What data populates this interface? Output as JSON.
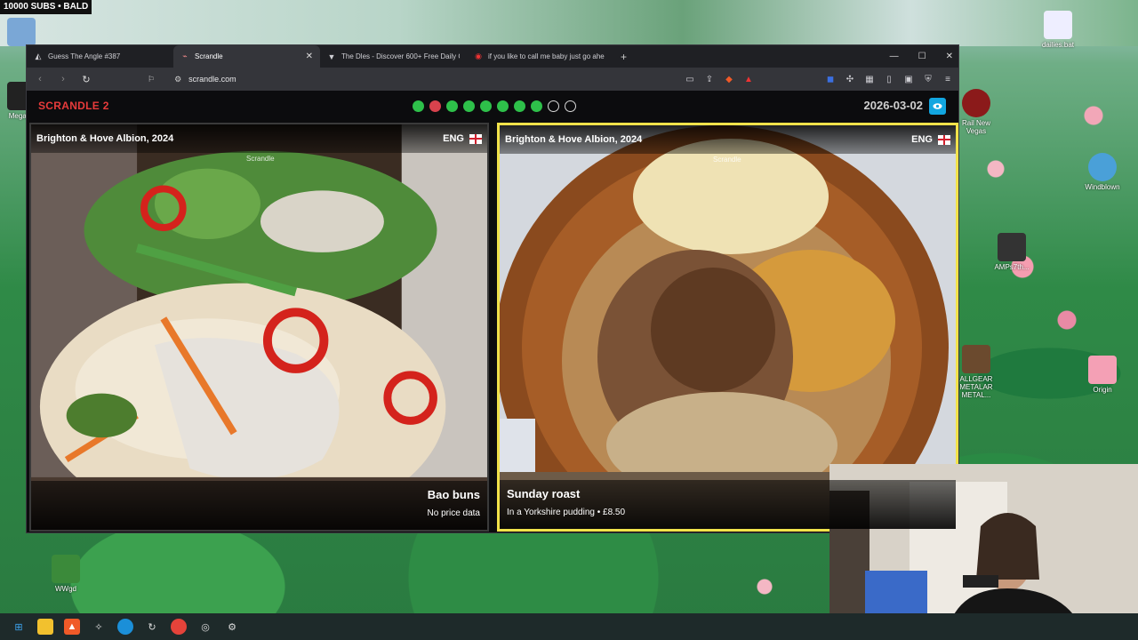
{
  "desktop": {
    "banner": "10000 SUBS • BALD",
    "icons_left": [
      "Megal..."
    ],
    "icons_right": [
      "dailies.bat",
      "Windblown",
      "AMPs7th...",
      "Origin",
      "ALLGEAR METALAR METAL...",
      "Rail New Vegas"
    ],
    "icon_bottom": "WWgd"
  },
  "browser": {
    "tabs": [
      {
        "icon": "compass-icon",
        "label": "Guess The Angle #387"
      },
      {
        "icon": "scrandle-icon",
        "label": "Scrandle",
        "active": true
      },
      {
        "icon": "v-icon",
        "label": "The Dles - Discover 600+ Free Daily G"
      },
      {
        "icon": "record-icon",
        "label": "if you like to call me baby just go ahe"
      }
    ],
    "url": "scrandle.com"
  },
  "app": {
    "title": "SCRANDLE 2",
    "date": "2026-03-02",
    "progress": [
      "green",
      "red",
      "green",
      "green",
      "green",
      "green",
      "green",
      "green",
      "empty",
      "empty"
    ]
  },
  "cards": {
    "left": {
      "team": "Brighton & Hove Albion, 2024",
      "lang": "ENG",
      "watermark": "Scrandle",
      "dish": "Bao buns",
      "detail": "No price data"
    },
    "right": {
      "team": "Brighton & Hove Albion, 2024",
      "lang": "ENG",
      "watermark": "Scrandle",
      "dish": "Sunday roast",
      "detail": "In a Yorkshire pudding • £8.50"
    }
  },
  "colors": {
    "brand": "#e83b3b",
    "selected_border": "#f1e24a",
    "correct": "#2ec04a",
    "wrong": "#d8424d",
    "eye_button": "#12a6e0"
  }
}
